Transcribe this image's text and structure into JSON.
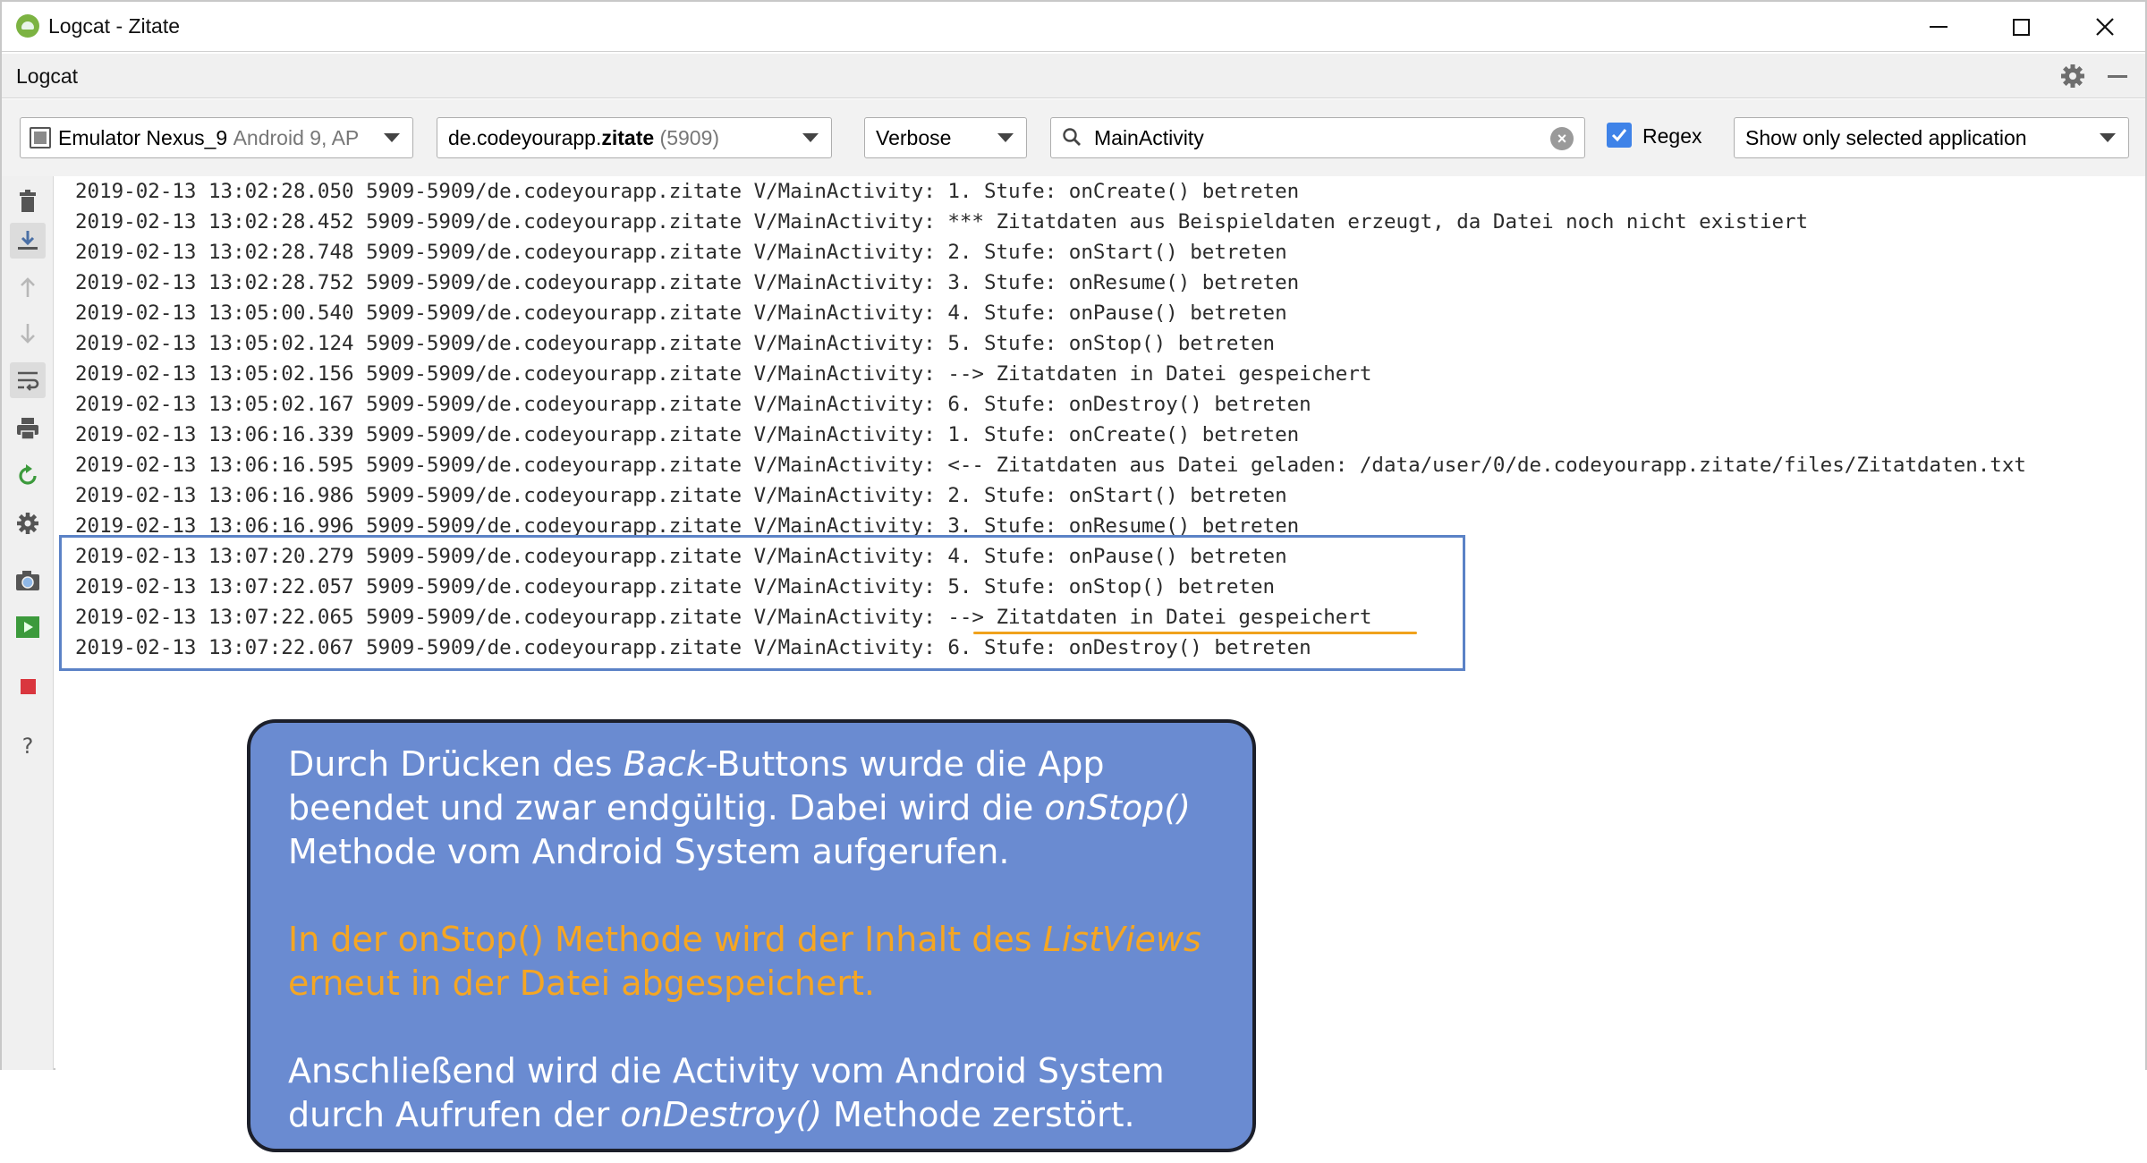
{
  "window": {
    "title": "Logcat - Zitate"
  },
  "tool_window": {
    "title": "Logcat"
  },
  "filter_bar": {
    "device_name": "Emulator Nexus_9",
    "device_detail": "Android 9, AP",
    "process_prefix": "de.codeyourapp.",
    "process_bold": "zitate",
    "process_pid": "(5909)",
    "log_level": "Verbose",
    "search_value": "MainActivity",
    "regex_label": "Regex",
    "regex_checked": true,
    "app_filter": "Show only selected application"
  },
  "log_lines": [
    "2019-02-13 13:02:28.050 5909-5909/de.codeyourapp.zitate V/MainActivity: 1. Stufe: onCreate() betreten",
    "2019-02-13 13:02:28.452 5909-5909/de.codeyourapp.zitate V/MainActivity: *** Zitatdaten aus Beispieldaten erzeugt, da Datei noch nicht existiert",
    "2019-02-13 13:02:28.748 5909-5909/de.codeyourapp.zitate V/MainActivity: 2. Stufe: onStart() betreten",
    "2019-02-13 13:02:28.752 5909-5909/de.codeyourapp.zitate V/MainActivity: 3. Stufe: onResume() betreten",
    "2019-02-13 13:05:00.540 5909-5909/de.codeyourapp.zitate V/MainActivity: 4. Stufe: onPause() betreten",
    "2019-02-13 13:05:02.124 5909-5909/de.codeyourapp.zitate V/MainActivity: 5. Stufe: onStop() betreten",
    "2019-02-13 13:05:02.156 5909-5909/de.codeyourapp.zitate V/MainActivity: --> Zitatdaten in Datei gespeichert",
    "2019-02-13 13:05:02.167 5909-5909/de.codeyourapp.zitate V/MainActivity: 6. Stufe: onDestroy() betreten",
    "2019-02-13 13:06:16.339 5909-5909/de.codeyourapp.zitate V/MainActivity: 1. Stufe: onCreate() betreten",
    "2019-02-13 13:06:16.595 5909-5909/de.codeyourapp.zitate V/MainActivity: <-- Zitatdaten aus Datei geladen: /data/user/0/de.codeyourapp.zitate/files/Zitatdaten.txt",
    "2019-02-13 13:06:16.986 5909-5909/de.codeyourapp.zitate V/MainActivity: 2. Stufe: onStart() betreten",
    "2019-02-13 13:06:16.996 5909-5909/de.codeyourapp.zitate V/MainActivity: 3. Stufe: onResume() betreten",
    "2019-02-13 13:07:20.279 5909-5909/de.codeyourapp.zitate V/MainActivity: 4. Stufe: onPause() betreten",
    "2019-02-13 13:07:22.057 5909-5909/de.codeyourapp.zitate V/MainActivity: 5. Stufe: onStop() betreten",
    "2019-02-13 13:07:22.065 5909-5909/de.codeyourapp.zitate V/MainActivity: --> Zitatdaten in Datei gespeichert",
    "2019-02-13 13:07:22.067 5909-5909/de.codeyourapp.zitate V/MainActivity: 6. Stufe: onDestroy() betreten"
  ],
  "sidebar_icons": [
    "trash-icon",
    "scroll-to-end-icon",
    "arrow-up-icon",
    "arrow-down-icon",
    "soft-wrap-icon",
    "print-icon",
    "restart-icon",
    "settings-icon",
    "screenshot-icon",
    "screen-record-icon",
    "stop-icon",
    "help-icon"
  ],
  "callout": {
    "p1_a": "Durch Drücken des ",
    "p1_b": "Back",
    "p1_c": "-Buttons wurde die App beendet und zwar endgültig. Dabei wird die ",
    "p1_d": "onStop()",
    "p1_e": " Methode vom Android System aufgerufen.",
    "p2_a": "In der onStop() Methode wird der Inhalt des ",
    "p2_b": "ListViews",
    "p2_c": " erneut in der Datei abgespeichert.",
    "p3_a": "Anschließend wird die Activity vom Android System durch Aufrufen der ",
    "p3_b": "onDestroy()",
    "p3_c": " Methode zerstört."
  },
  "colors": {
    "highlight_box": "#5b82c6",
    "underline": "#f0a21c",
    "callout_bg": "#6a8bd1",
    "callout_orange": "#f5a623",
    "checkbox": "#3f83e8"
  }
}
